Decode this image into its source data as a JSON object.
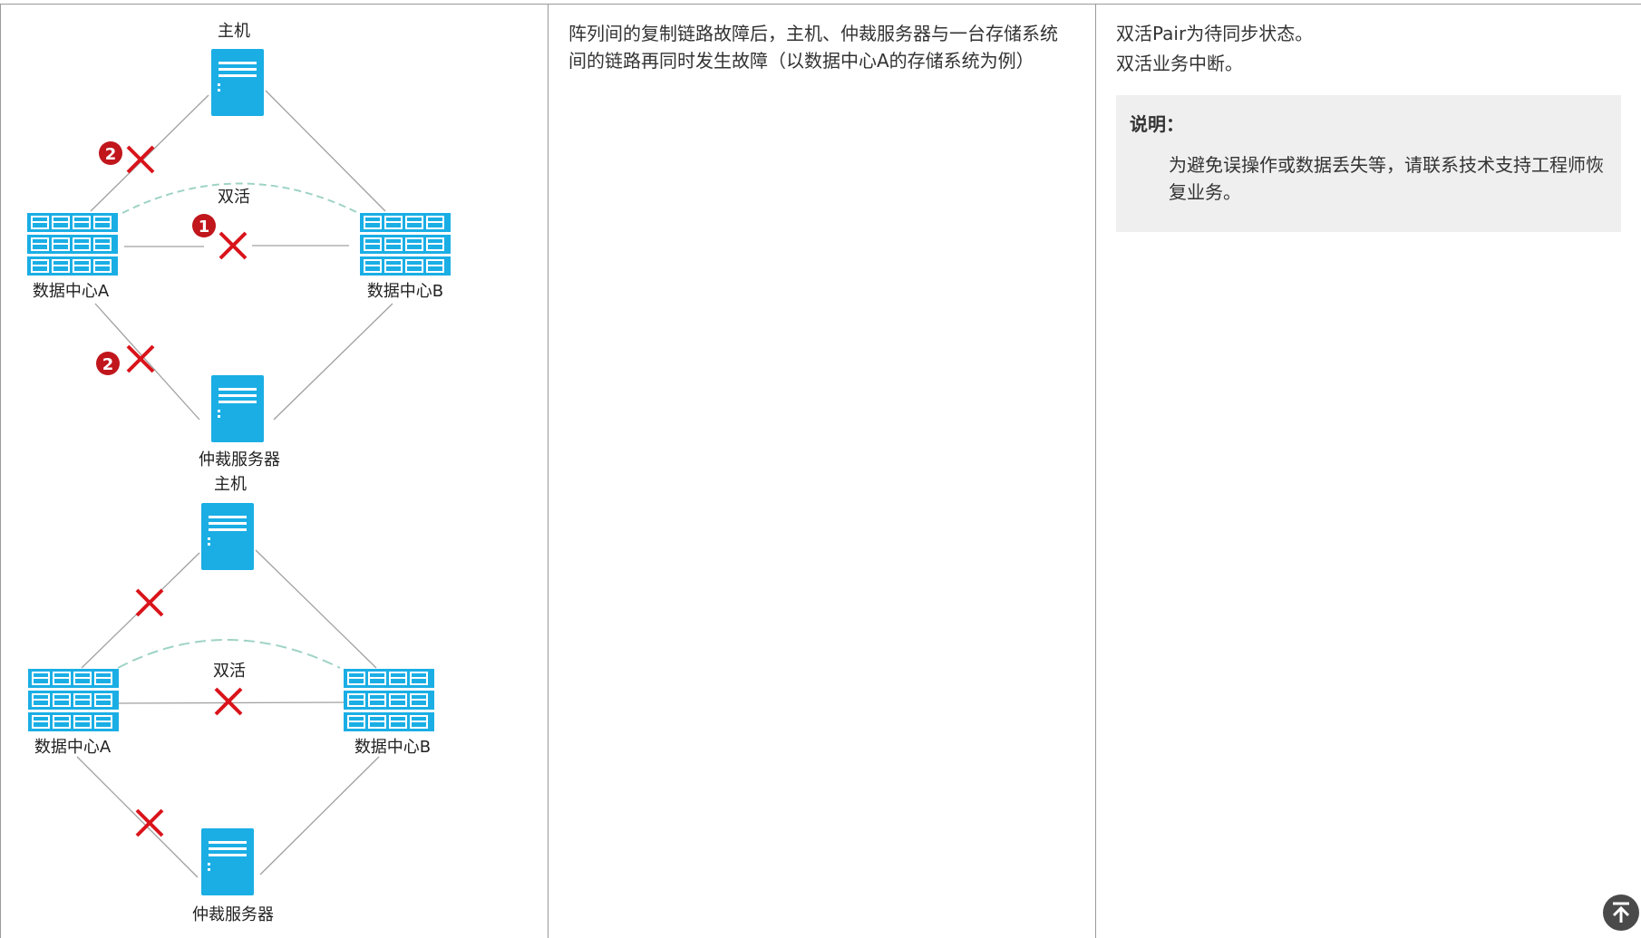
{
  "row": {
    "scenario": "阵列间的复制链路故障后，主机、仲裁服务器与一台存储系统间的链路再同时发生故障（以数据中心A的存储系统为例）",
    "result_lines": [
      "双活Pair为待同步状态。",
      "双活业务中断。"
    ],
    "note": {
      "title": "说明：",
      "body": "为避免误操作或数据丢失等，请联系技术支持工程师恢复业务。"
    }
  },
  "diagram_top": {
    "host_label": "主机",
    "dc_a_label": "数据中心A",
    "dc_b_label": "数据中心B",
    "arbiter_label": "仲裁服务器",
    "active_active_label": "双活",
    "step1_marker": "1",
    "step2_marker": "2"
  },
  "diagram_bottom": {
    "host_label": "主机",
    "dc_a_label": "数据中心A",
    "dc_b_label": "数据中心B",
    "arbiter_label": "仲裁服务器",
    "active_active_label": "双活"
  },
  "colors": {
    "device": "#1aaee5",
    "fault_mark": "#d9141b",
    "link": "#a0a0a0",
    "dashed_arc": "#9fd3c6",
    "step_badge": "#c0161c"
  },
  "icons": {
    "back_to_top": "arrow-up-to-line-icon"
  }
}
